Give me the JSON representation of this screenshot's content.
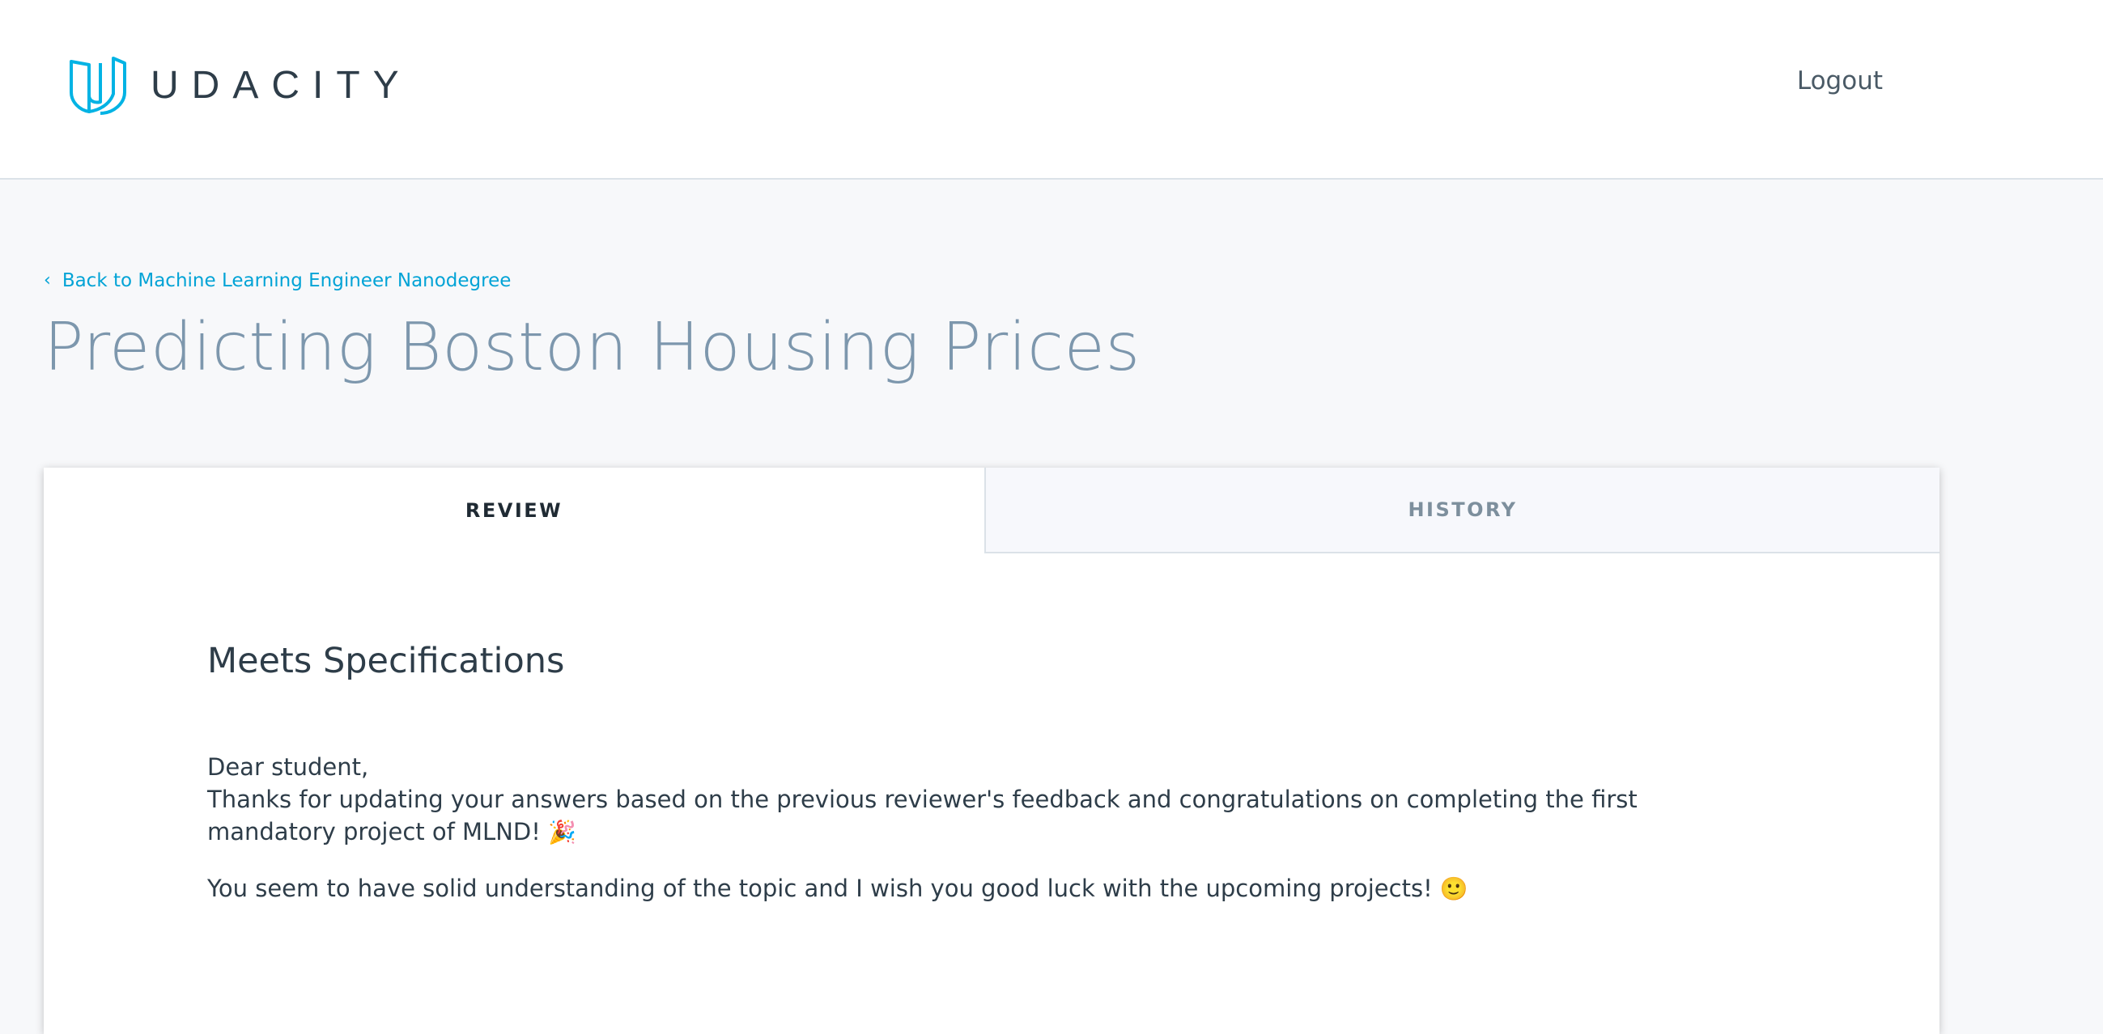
{
  "header": {
    "logo_text": "UDACITY",
    "logout_label": "Logout"
  },
  "nav": {
    "back_icon": "chevron-left-icon",
    "back_label": "Back to Machine Learning Engineer Nanodegree"
  },
  "page": {
    "title": "Predicting Boston Housing Prices"
  },
  "tabs": [
    {
      "label": "REVIEW",
      "active": true
    },
    {
      "label": "HISTORY",
      "active": false
    }
  ],
  "review": {
    "status": "Meets Specifications",
    "greeting": "Dear student,",
    "line1": "Thanks for updating your answers based on the previous reviewer's feedback and congratulations on completing the first mandatory project of MLND!",
    "emoji1": "🎉",
    "line2": "You seem to have solid understanding of the topic and I wish you good luck with the upcoming projects!",
    "emoji2": "🙂"
  },
  "colors": {
    "brand": "#02b3e4",
    "link": "#02a3d6",
    "title": "#7d97ad",
    "background": "#f7f8fa"
  }
}
